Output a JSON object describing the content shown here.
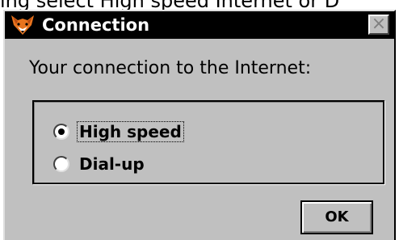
{
  "background_caption": "ing select High speed Internet or D",
  "window": {
    "title": "Connection",
    "close_symbol": "×",
    "icon": "fox-app-icon",
    "titlebar_color": "#000000",
    "face_color": "#c0c0c0"
  },
  "dialog": {
    "prompt": "Your connection to the Internet:",
    "options": [
      {
        "label": "High speed",
        "selected": true
      },
      {
        "label": "Dial-up",
        "selected": false
      }
    ],
    "ok_label": "OK"
  }
}
